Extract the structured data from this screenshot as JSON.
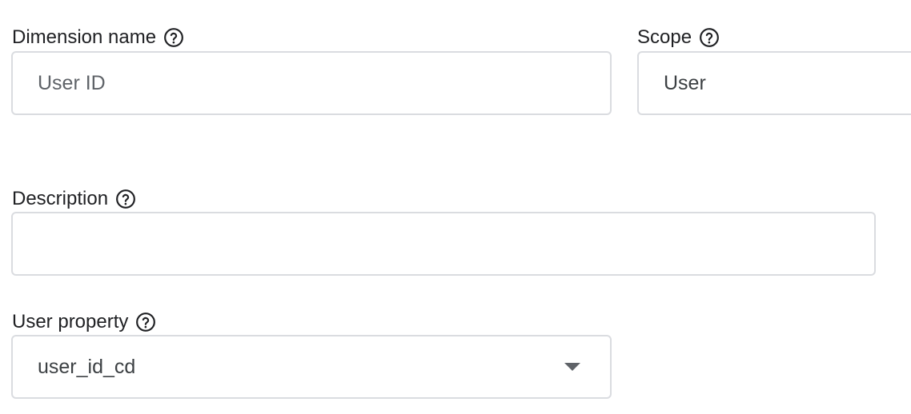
{
  "dimension_name": {
    "label": "Dimension name",
    "value": "User ID",
    "help_icon": "help-circle-icon"
  },
  "scope": {
    "label": "Scope",
    "value": "User",
    "help_icon": "help-circle-icon"
  },
  "description": {
    "label": "Description",
    "value": "",
    "help_icon": "help-circle-icon"
  },
  "user_property": {
    "label": "User property",
    "value": "user_id_cd",
    "help_icon": "help-circle-icon",
    "dropdown_icon": "dropdown-arrow-icon"
  },
  "colors": {
    "border": "#dadce0",
    "text": "#202124",
    "icon": "#202124",
    "arrow": "#5f6368"
  }
}
